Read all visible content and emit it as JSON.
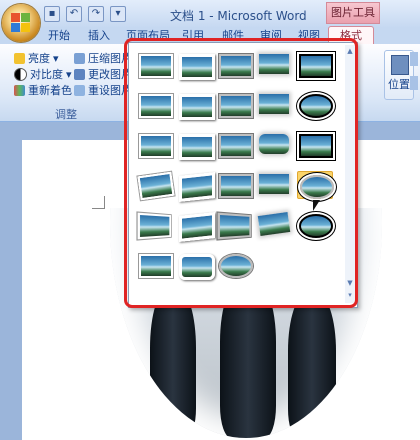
{
  "titlebar": {
    "doc_title": "文档 1 - Microsoft Word",
    "context_tab_title": "图片工具",
    "qat_icons": [
      "save-icon",
      "undo-icon",
      "redo-icon",
      "customize-icon"
    ]
  },
  "tabs": {
    "items": [
      "开始",
      "插入",
      "页面布局",
      "引用",
      "邮件",
      "审阅",
      "视图"
    ],
    "format": "格式"
  },
  "ribbon": {
    "adjust": {
      "brightness": "亮度",
      "contrast": "对比度",
      "recolor": "重新着色",
      "compress": "压缩图片",
      "change_picture": "更改图片",
      "reset_picture": "重设图片",
      "group_label": "调整"
    },
    "position_label": "位置"
  },
  "gallery": {
    "selected_index": 19,
    "rows": 6,
    "cols": 5,
    "count": 28,
    "style_names": [
      "simple-frame-white",
      "beveled-matte-white",
      "metal-frame",
      "soft-edge-rectangle",
      "double-frame-black",
      "reflected-rounded",
      "thick-matte-black",
      "simple-frame-black",
      "compound-frame-black",
      "center-shadow-rectangle",
      "moderate-frame-black",
      "simple-frame-black-2",
      "rounded-diagonal-corner",
      "soft-edge-rounded",
      "snip-diagonal",
      "rotated-white",
      "perspective-shadow",
      "relaxed-perspective",
      "drop-shadow",
      "soft-edge-oval",
      "reflected-perspective-left",
      "bevel-perspective",
      "perspective-right",
      "rotated-white-2",
      "reflected-bevel-black",
      "bevel-rectangle",
      "metal-rounded",
      "metal-oval"
    ]
  }
}
